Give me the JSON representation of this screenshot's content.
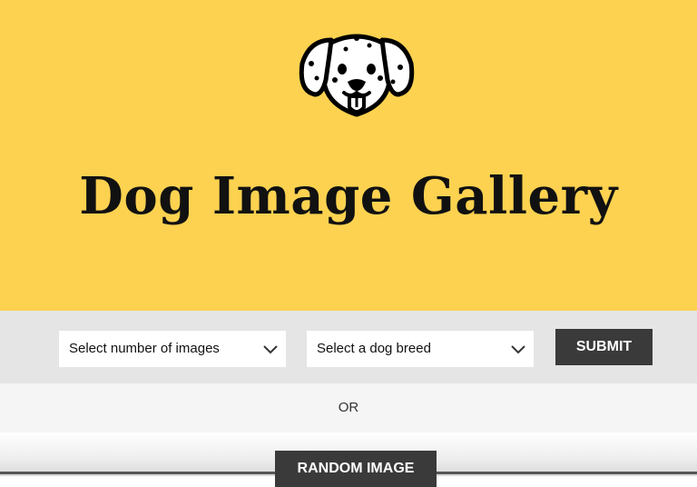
{
  "header": {
    "logo_icon": "dalmatian-dog-icon",
    "title": "Dog Image Gallery",
    "background": "#fdd250"
  },
  "controls": {
    "count_select": {
      "selected": "Select number of images"
    },
    "breed_select": {
      "selected": "Select a dog breed"
    },
    "submit_label": "SUBMIT"
  },
  "divider_text": "OR",
  "random_button_label": "RANDOM IMAGE"
}
